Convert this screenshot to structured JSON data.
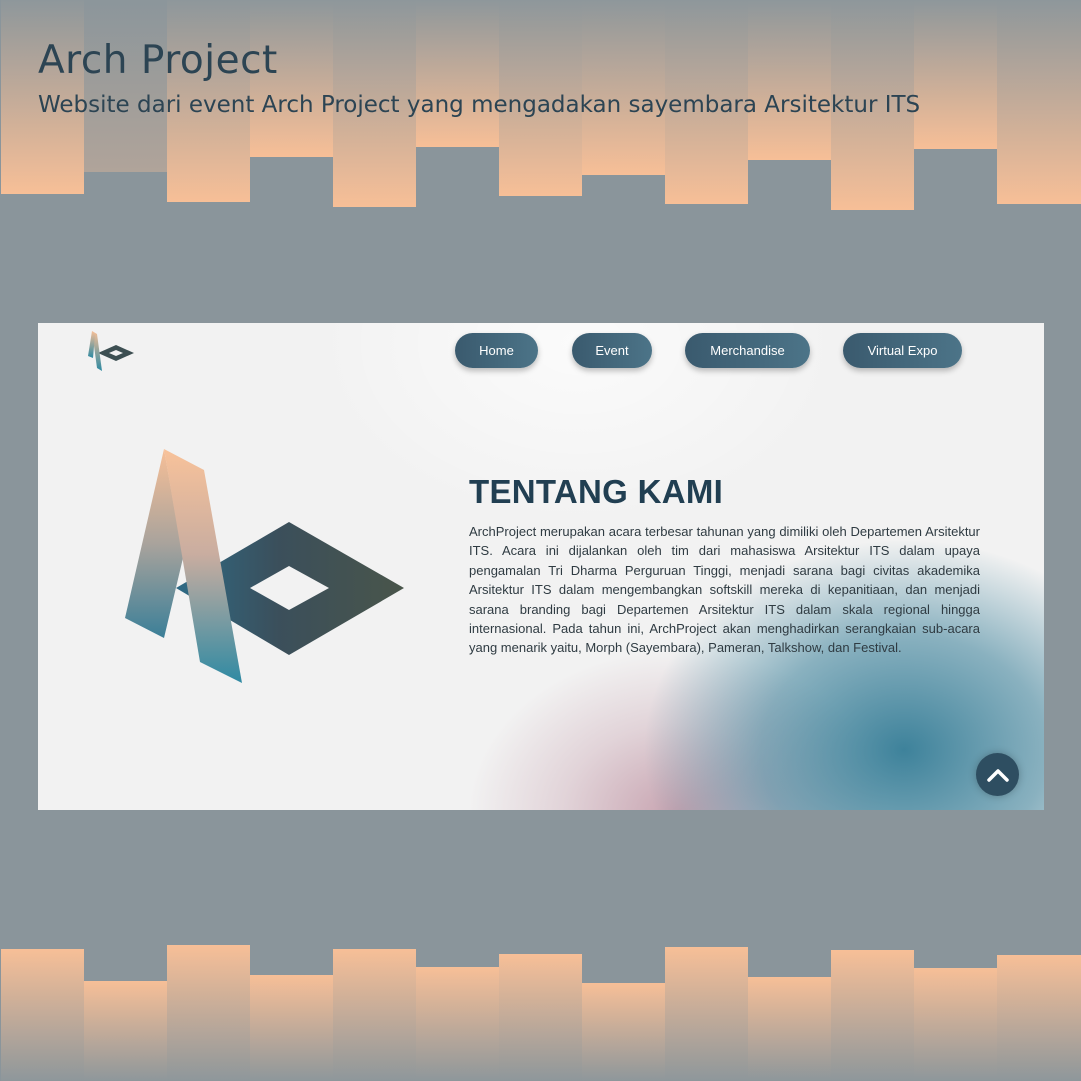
{
  "page": {
    "title": "Arch Project",
    "description": "Website dari event Arch Project yang mengadakan sayembara Arsitektur ITS"
  },
  "nav": {
    "logo_icon": "arch-project-logo-icon",
    "items": [
      {
        "label": "Home"
      },
      {
        "label": "Event"
      },
      {
        "label": "Merchandise"
      },
      {
        "label": "Virtual Expo"
      }
    ]
  },
  "about": {
    "heading": "TENTANG KAMI",
    "body": "ArchProject merupakan acara terbesar tahunan yang dimiliki oleh Departemen Arsitektur ITS. Acara ini dijalankan oleh tim dari mahasiswa Arsitektur ITS dalam upaya pengamalan Tri Dharma Perguruan Tinggi, menjadi sarana bagi civitas akademika Arsitektur ITS dalam mengembangkan softskill mereka di kepanitiaan, dan menjadi sarana branding bagi Departemen Arsitektur ITS dalam skala regional hingga internasional. Pada tahun ini, ArchProject akan menghadirkan serangkaian sub-acara yang menarik yaitu, Morph (Sayembara), Pameran, Talkshow, dan Festival."
  },
  "scroll_top": {
    "icon": "chevron-up-icon"
  },
  "colors": {
    "background": "#8a959b",
    "peach": "#f7bf97",
    "navy": "#213f52",
    "button": "#3e6176",
    "teal": "#347c96"
  }
}
